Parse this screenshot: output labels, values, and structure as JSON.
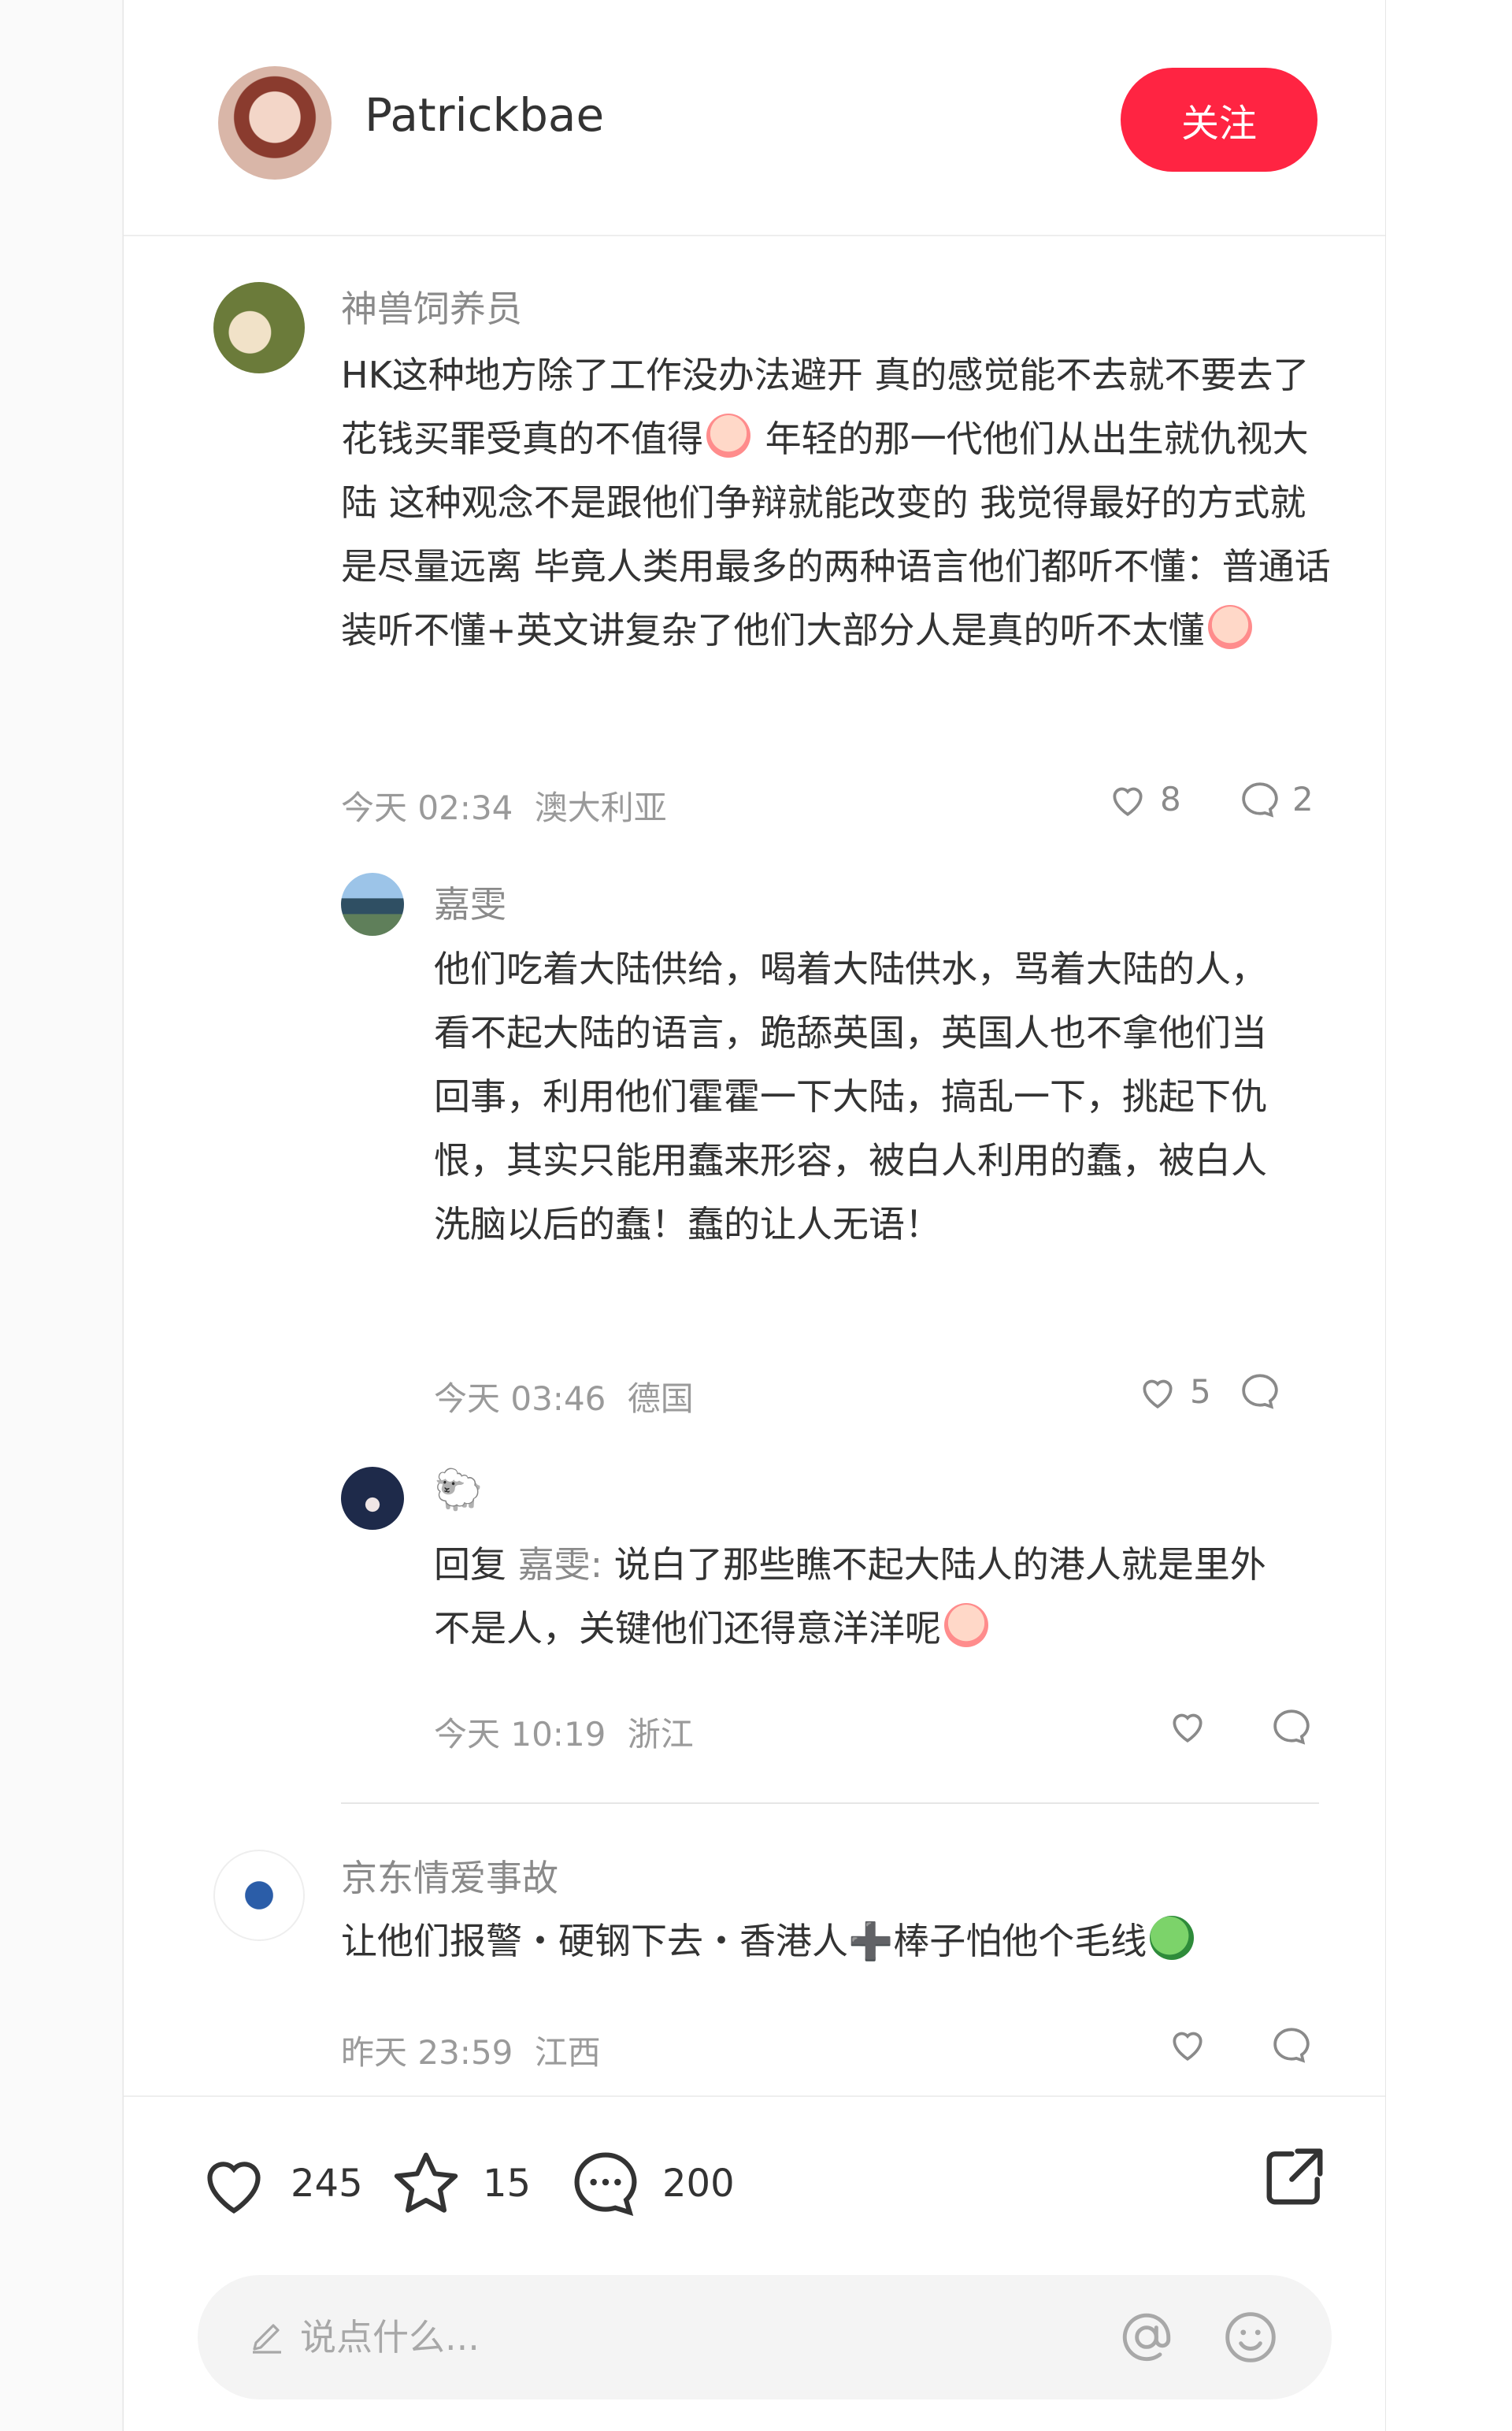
{
  "author": {
    "name": "Patrickbae",
    "follow_label": "关注"
  },
  "comments": [
    {
      "user": "神兽饲养员",
      "text": "HK这种地方除了工作没办法避开 真的感觉能不去就不要去了 花钱买罪受真的不值得",
      "text2": " 年轻的那一代他们从出生就仇视大陆 这种观念不是跟他们争辩就能改变的 我觉得最好的方式就是尽量远离 毕竟人类用最多的两种语言他们都听不懂：普通话装听不懂+英文讲复杂了他们大部分人是真的听不太懂",
      "time": "今天 02:34",
      "location": "澳大利亚",
      "likes": "8",
      "replies_count": "2"
    },
    {
      "user": "嘉雯",
      "text": "他们吃着大陆供给，喝着大陆供水，骂着大陆的人，看不起大陆的语言，跪舔英国，英国人也不拿他们当回事，利用他们霍霍一下大陆，搞乱一下，挑起下仇恨，其实只能用蠢来形容，被白人利用的蠢，被白人洗脑以后的蠢！蠢的让人无语！",
      "time": "今天 03:46",
      "location": "德国",
      "likes": "5"
    },
    {
      "user": "🐑",
      "reply_prefix": "回复",
      "reply_target": "嘉雯:",
      "text": " 说白了那些瞧不起大陆人的港人就是里外不是人，关键他们还得意洋洋呢",
      "time": "今天 10:19",
      "location": "浙江"
    },
    {
      "user": "京东情爱事故",
      "text": "让他们报警・硬钢下去・香港人",
      "cross": "➕",
      "text2": "棒子怕他个毛线",
      "time": "昨天 23:59",
      "location": "江西"
    }
  ],
  "bottom_bar": {
    "likes": "245",
    "stars": "15",
    "comments": "200",
    "input_placeholder": "说点什么..."
  },
  "colors": {
    "accent": "#ff2442",
    "muted_text": "#8a8a8a",
    "body_text": "#333333"
  }
}
